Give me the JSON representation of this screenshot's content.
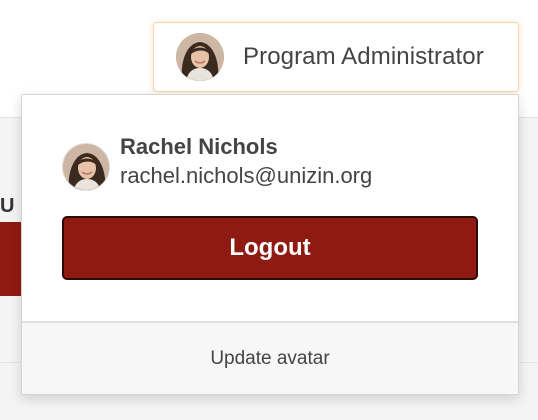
{
  "background": {
    "partial_letter": "U",
    "accent_color": "#8f1a12"
  },
  "header": {
    "user_menu": {
      "avatar_icon": "user-avatar-photo",
      "role_label": "Program Administrator"
    }
  },
  "dropdown": {
    "profile": {
      "avatar_icon": "user-avatar-photo",
      "name": "Rachel Nichols",
      "email": "rachel.nichols@unizin.org"
    },
    "logout_label": "Logout",
    "update_avatar_label": "Update avatar",
    "logout_color": "#8f1a12"
  }
}
